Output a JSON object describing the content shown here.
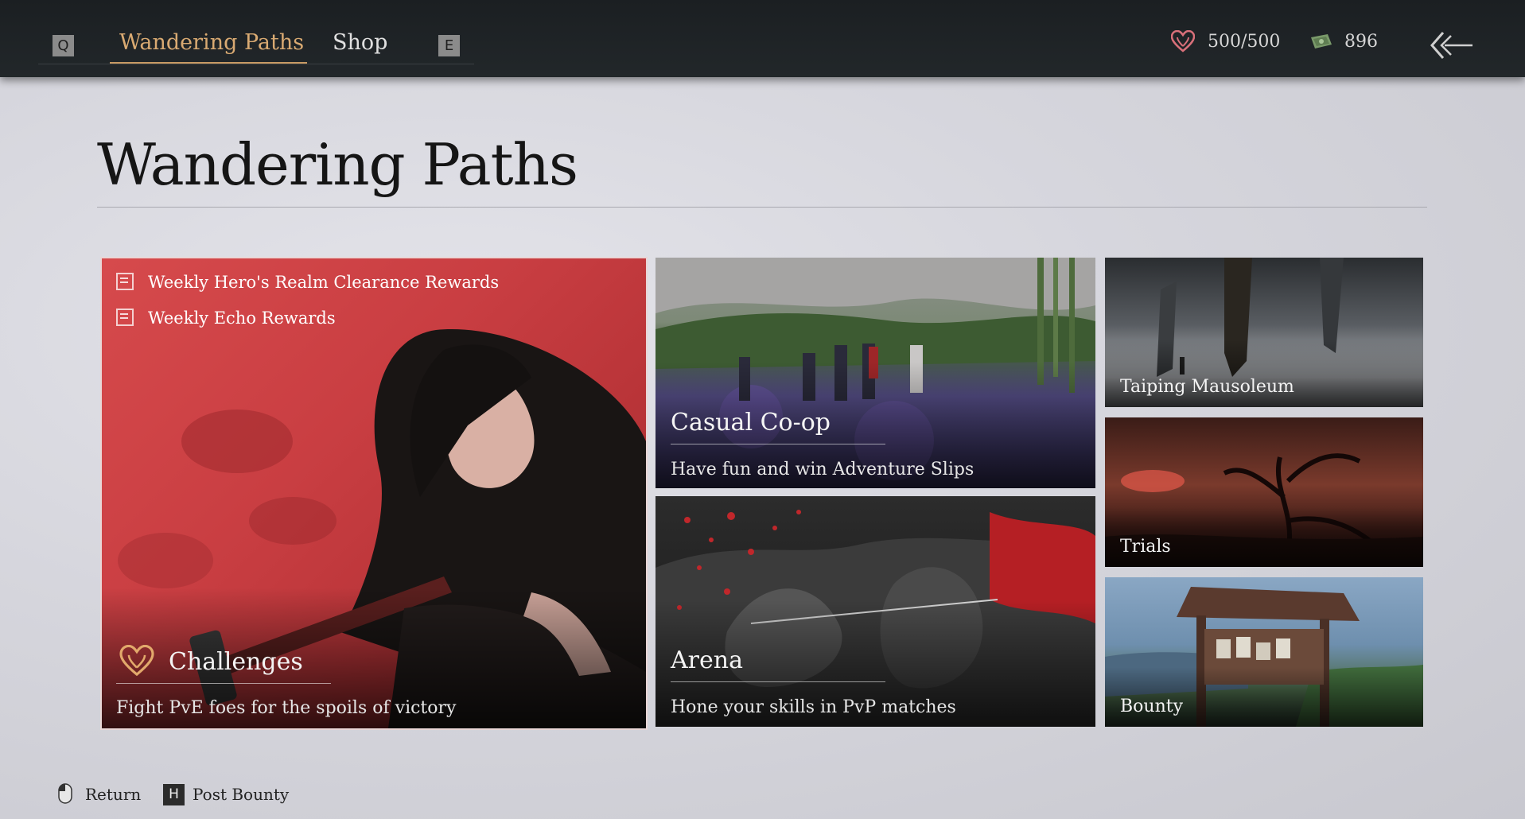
{
  "topbar": {
    "tab_prev_key": "Q",
    "tab_next_key": "E",
    "tabs": [
      {
        "label": "Wandering Paths",
        "active": true
      },
      {
        "label": "Shop",
        "active": false
      }
    ],
    "currency": [
      {
        "icon": "heart-icon",
        "value": "500/500"
      },
      {
        "icon": "banknote-icon",
        "value": "896"
      }
    ],
    "back_icon": "back-arrow-icon"
  },
  "page": {
    "title": "Wandering Paths"
  },
  "cards": {
    "challenges": {
      "name": "Challenges",
      "description": "Fight PvE foes for the spoils of victory",
      "rewards": [
        "Weekly Hero's Realm Clearance Rewards",
        "Weekly Echo Rewards"
      ]
    },
    "casual_coop": {
      "name": "Casual Co-op",
      "description": "Have fun and win Adventure Slips"
    },
    "arena": {
      "name": "Arena",
      "description": "Hone your skills in PvP matches"
    },
    "taiping": {
      "name": "Taiping Mausoleum"
    },
    "trials": {
      "name": "Trials"
    },
    "bounty": {
      "name": "Bounty"
    }
  },
  "footer": {
    "return_label": "Return",
    "post_bounty_key": "H",
    "post_bounty_label": "Post Bounty"
  },
  "colors": {
    "active_tab": "#d9aa72",
    "topbar": "#1f2326",
    "challenges_red": "#d23e40"
  }
}
